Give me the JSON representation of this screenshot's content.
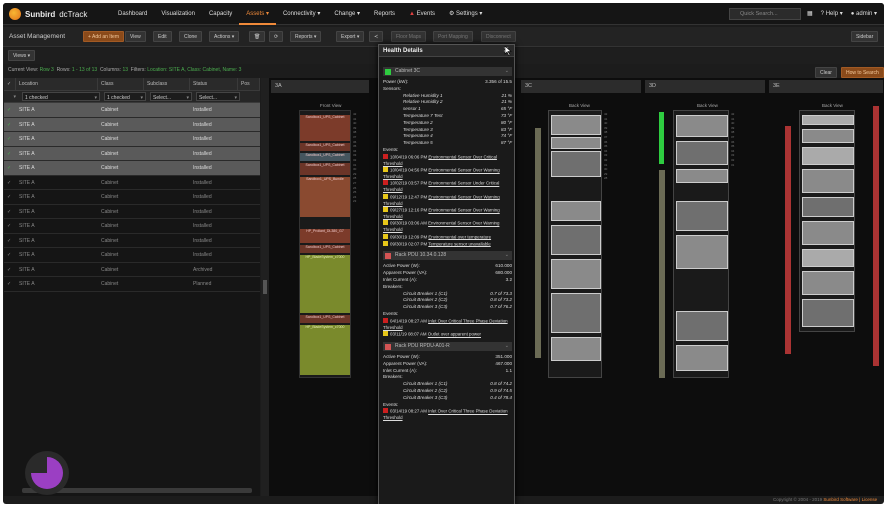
{
  "app": {
    "brand": "Sunbird",
    "product": "dcTrack"
  },
  "nav": {
    "items": [
      "Dashboard",
      "Visualization",
      "Capacity",
      "Assets ▾",
      "Connectivity ▾",
      "Change ▾",
      "Reports",
      "Events",
      "Settings ▾"
    ]
  },
  "search": {
    "placeholder": "Quick Search..."
  },
  "topright": {
    "help": "Help ▾",
    "user": "admin ▾"
  },
  "toolbar": {
    "title": "Asset Management",
    "add": "+ Add an Item",
    "view": "View",
    "edit": "Edit",
    "clone": "Clone",
    "actions": "Actions ▾",
    "reports": "Reports ▾",
    "export": "Export ▾",
    "floormaps": "Floor Maps",
    "portmap": "Port Mapping",
    "disconnect": "Disconnect",
    "sidebar": "Sidebar"
  },
  "views": "Views ▾",
  "statusbar": {
    "current_view": "Current View:",
    "view_name": "Row 3",
    "rows": "Rows:",
    "rows_val": "1 - 13 of 13",
    "columns": "Columns:",
    "columns_val": "13",
    "filters": "Filters:",
    "filters_val": "Location: SITE A,  Class: Cabinet,  Name: 3"
  },
  "canvas_buttons": {
    "clear": "Clear",
    "zoom": "How to Search"
  },
  "grid": {
    "headers": [
      "Location",
      "Class",
      "Subclass",
      "Status",
      "Pos"
    ],
    "filters": [
      "1 checked",
      "1 checked",
      "Select...",
      "Select..."
    ],
    "rows": [
      {
        "loc": "SITE A",
        "cls": "Cabinet",
        "status": "Installed"
      },
      {
        "loc": "SITE A",
        "cls": "Cabinet",
        "status": "Installed"
      },
      {
        "loc": "SITE A",
        "cls": "Cabinet",
        "status": "Installed"
      },
      {
        "loc": "SITE A",
        "cls": "Cabinet",
        "status": "Installed"
      },
      {
        "loc": "SITE A",
        "cls": "Cabinet",
        "status": "Installed"
      },
      {
        "loc": "SITE A",
        "cls": "Cabinet",
        "status": "Installed"
      },
      {
        "loc": "SITE A",
        "cls": "Cabinet",
        "status": "Installed"
      },
      {
        "loc": "SITE A",
        "cls": "Cabinet",
        "status": "Installed"
      },
      {
        "loc": "SITE A",
        "cls": "Cabinet",
        "status": "Installed"
      },
      {
        "loc": "SITE A",
        "cls": "Cabinet",
        "status": "Installed"
      },
      {
        "loc": "SITE A",
        "cls": "Cabinet",
        "status": "Installed"
      },
      {
        "loc": "SITE A",
        "cls": "Cabinet",
        "status": "Archived"
      },
      {
        "loc": "SITE A",
        "cls": "Cabinet",
        "status": "Planned"
      }
    ]
  },
  "columns": [
    "3A",
    "3C",
    "3D",
    "3E"
  ],
  "rack_labels": {
    "front": "Front View",
    "back": "Back View"
  },
  "popup": {
    "title": "Health Details",
    "cabinet": {
      "name": "Cabinet 3C",
      "power_label": "Power (kW):",
      "power_val": "3.356 of 15.5",
      "sensors_label": "Sensors:",
      "sensors": [
        {
          "k": "Relative Humidity 1",
          "v": "21 %"
        },
        {
          "k": "Relative Humidity 2",
          "v": "21 %"
        },
        {
          "k": "sensor 1",
          "v": "65 °F"
        },
        {
          "k": "Temperature 7 Test",
          "v": "73 °F"
        },
        {
          "k": "Temperature 2",
          "v": "80 °F"
        },
        {
          "k": "Temperature 3",
          "v": "83 °F"
        },
        {
          "k": "Temperature 4",
          "v": "74 °F"
        },
        {
          "k": "Temperature 5",
          "v": "87 °F"
        }
      ],
      "events_label": "Events:",
      "events": [
        {
          "c": "#cc2020",
          "t": "10/04/19 06:06 PM",
          "d": "Environmental Sensor Over Critical Threshold"
        },
        {
          "c": "#e6c619",
          "t": "10/04/19 04:56 PM",
          "d": "Environmental Sensor Over Warning Threshold"
        },
        {
          "c": "#cc2020",
          "t": "10/02/19 03:57 PM",
          "d": "Environmental Sensor Under Critical Threshold"
        },
        {
          "c": "#e6c619",
          "t": "09/12/19 12:47 PM",
          "d": "Environmental Sensor Over Warning Threshold"
        },
        {
          "c": "#e6c619",
          "t": "09/27/19 12:16 PM",
          "d": "Environmental Sensor Over Warning Threshold"
        },
        {
          "c": "#e6c619",
          "t": "09/30/19 03:06 AM",
          "d": "Environmental Sensor Over Warning Threshold"
        },
        {
          "c": "#e6c619",
          "t": "09/30/19 12:09 PM",
          "d": "Environmental over temperature"
        },
        {
          "c": "#e6c619",
          "t": "09/30/19 02:07 PM",
          "d": "Temperature sensor unavailable"
        }
      ]
    },
    "pdu1": {
      "name": "Rack PDU 10.34.0.128",
      "rows": [
        {
          "k": "Active Power (W):",
          "v": "610.000"
        },
        {
          "k": "Apparent Power (VA):",
          "v": "680.000"
        },
        {
          "k": "Inlet Current (A):",
          "v": "3.2"
        }
      ],
      "breakers_label": "Breakers:",
      "breakers": [
        {
          "k": "Circuit Breaker 1 (C1)",
          "v": "0.7 of 73.3"
        },
        {
          "k": "Circuit Breaker 2 (C2)",
          "v": "0.8 of 73.2"
        },
        {
          "k": "Circuit Breaker 3 (C3)",
          "v": "0.7 of 76.2"
        }
      ],
      "events_label": "Events:",
      "events": [
        {
          "c": "#cc2020",
          "t": "04/14/19 08:27 AM",
          "d": "Inlet Over Critical Three Phase Deviation Threshold"
        },
        {
          "c": "#e6c619",
          "t": "03/11/19 08:07 AM",
          "d": "Outlet over apparent power"
        }
      ]
    },
    "pdu2": {
      "name": "Rack PDU RPDU-A01-R",
      "rows": [
        {
          "k": "Active Power (W):",
          "v": "351.000"
        },
        {
          "k": "Apparent Power (VA):",
          "v": "467.000"
        },
        {
          "k": "Inlet Current (A):",
          "v": "1.1"
        }
      ],
      "breakers_label": "Breakers:",
      "breakers": [
        {
          "k": "Circuit Breaker 1 (C1)",
          "v": "0.8 of 74.2"
        },
        {
          "k": "Circuit Breaker 2 (C2)",
          "v": "0.9 of 74.5"
        },
        {
          "k": "Circuit Breaker 3 (C3)",
          "v": "0.4 of 78.4"
        }
      ],
      "events_label": "Events:",
      "events": [
        {
          "c": "#cc2020",
          "t": "03/14/19 08:27 AM",
          "d": "Inlet Over Critical Three Phase Deviation Threshold"
        }
      ]
    }
  },
  "copyright": {
    "text": "Copyright © 2004 - 2019",
    "company": "Sunbird Software | License"
  }
}
